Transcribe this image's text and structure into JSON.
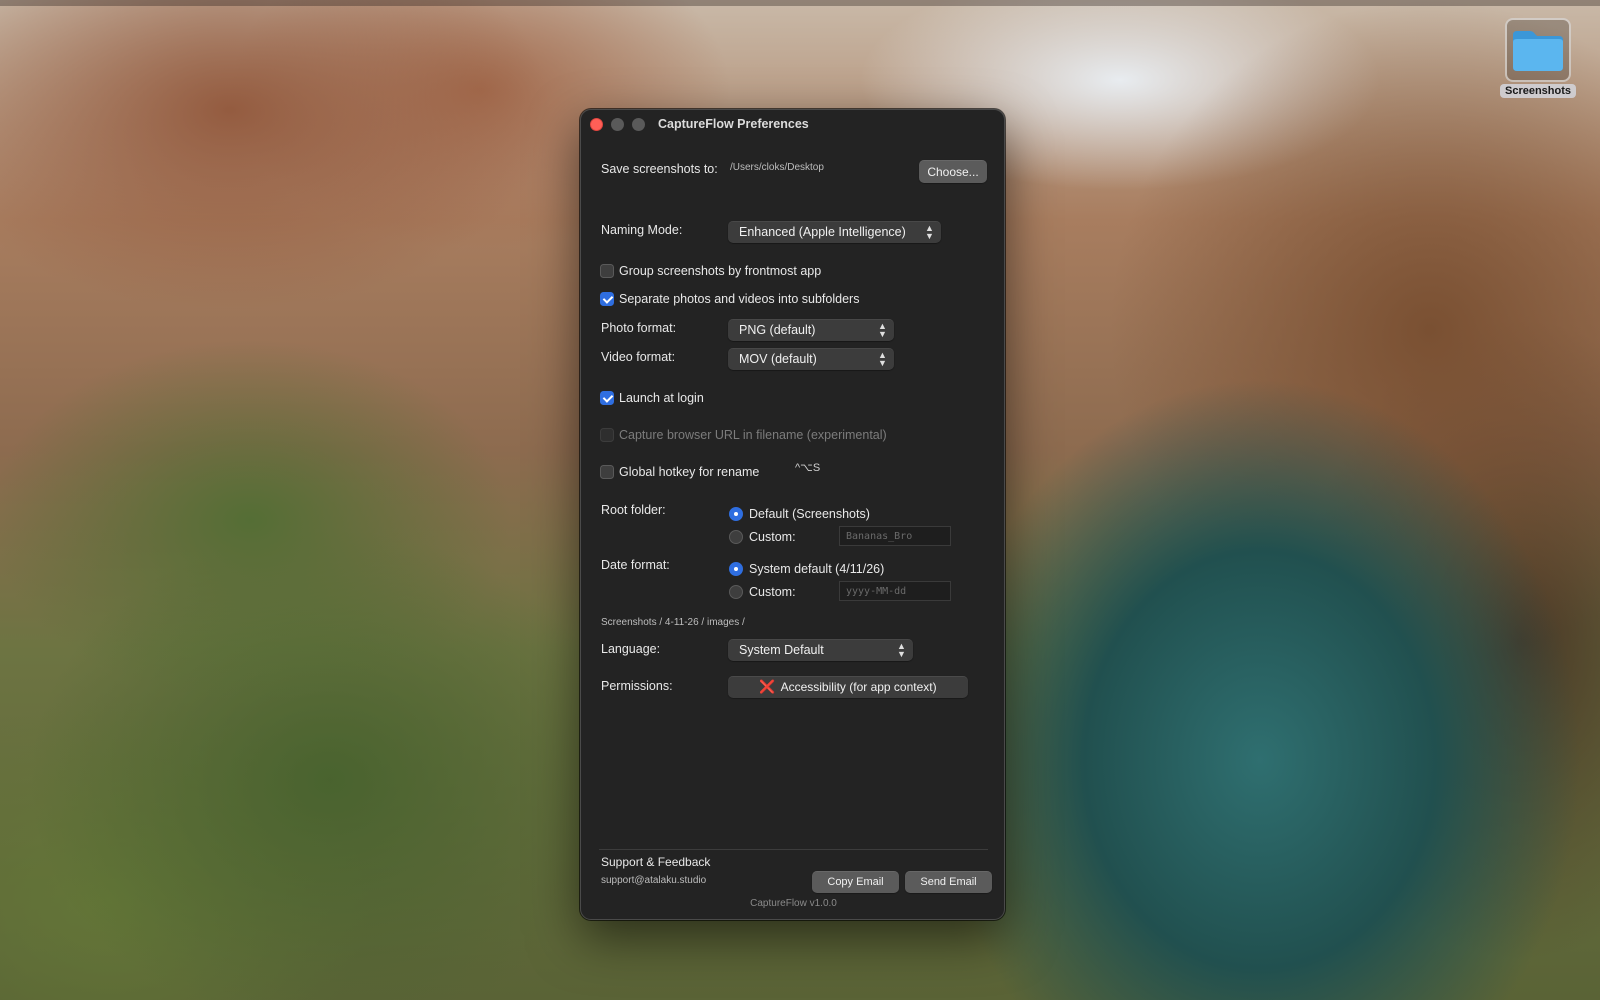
{
  "desktop": {
    "folder_label": "Screenshots",
    "folder_color": "#5bb6ef"
  },
  "window": {
    "title": "CaptureFlow Preferences",
    "save": {
      "label": "Save screenshots to:",
      "path": "/Users/cloks/Desktop",
      "choose_button": "Choose..."
    },
    "naming_mode": {
      "label": "Naming Mode:",
      "value": "Enhanced (Apple Intelligence)"
    },
    "options": {
      "group_by_app": {
        "label": "Group screenshots by frontmost app",
        "checked": false
      },
      "separate_media": {
        "label": "Separate photos and videos into subfolders",
        "checked": true
      }
    },
    "photo_format": {
      "label": "Photo format:",
      "value": "PNG (default)"
    },
    "video_format": {
      "label": "Video format:",
      "value": "MOV (default)"
    },
    "launch_at_login": {
      "label": "Launch at login",
      "checked": true
    },
    "capture_url": {
      "label": "Capture browser URL in filename (experimental)",
      "enabled": false
    },
    "global_hotkey": {
      "label": "Global hotkey for rename",
      "shortcut": "^⌥S",
      "checked": false
    },
    "root_folder": {
      "label": "Root folder:",
      "default_option": "Default (Screenshots)",
      "custom_option": "Custom:",
      "custom_placeholder": "Bananas_Bro",
      "selected": "default"
    },
    "date_format": {
      "label": "Date format:",
      "default_option": "System default (4/11/26)",
      "custom_option": "Custom:",
      "custom_placeholder": "yyyy-MM-dd",
      "selected": "default"
    },
    "path_preview": "Screenshots / 4-11-26 / images /",
    "language": {
      "label": "Language:",
      "value": "System Default"
    },
    "permissions": {
      "label": "Permissions:",
      "status_icon": "❌",
      "button": "Accessibility (for app context)"
    },
    "support": {
      "title": "Support & Feedback",
      "email": "support@atalaku.studio",
      "copy_button": "Copy Email",
      "send_button": "Send Email"
    },
    "version": "CaptureFlow v1.0.0"
  },
  "colors": {
    "accent": "#2f6ee0",
    "window_bg": "#232323",
    "close_button": "#ff5f57"
  }
}
